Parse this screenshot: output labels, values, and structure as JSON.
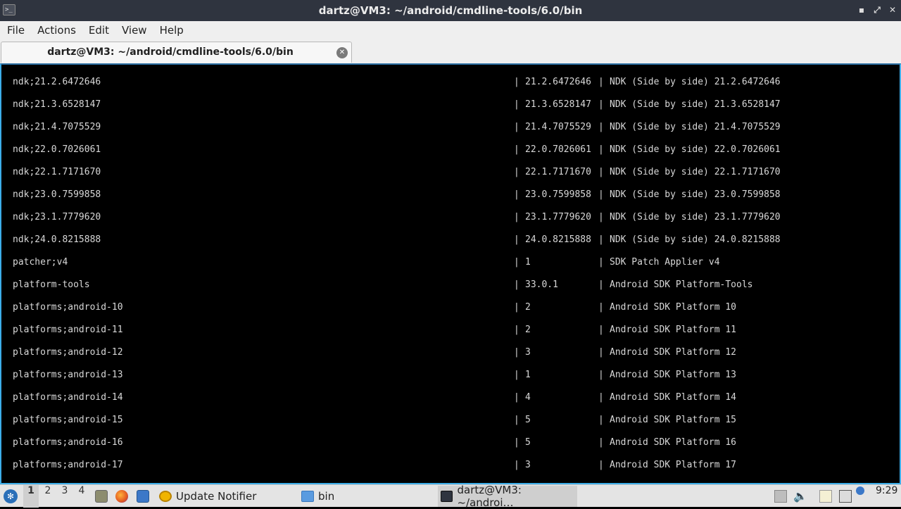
{
  "window": {
    "title": "dartz@VM3: ~/android/cmdline-tools/6.0/bin",
    "app_icon": "terminal-icon",
    "controls": {
      "minimize": "▪",
      "maximize": "⤢",
      "close": "✕"
    }
  },
  "menu": [
    "File",
    "Actions",
    "Edit",
    "View",
    "Help"
  ],
  "tab": {
    "label": "dartz@VM3: ~/android/cmdline-tools/6.0/bin",
    "close": "✕"
  },
  "terminal": {
    "separator": "|",
    "rows": [
      {
        "path": "ndk;21.2.6472646",
        "version": "21.2.6472646",
        "description": "NDK (Side by side) 21.2.6472646"
      },
      {
        "path": "ndk;21.3.6528147",
        "version": "21.3.6528147",
        "description": "NDK (Side by side) 21.3.6528147"
      },
      {
        "path": "ndk;21.4.7075529",
        "version": "21.4.7075529",
        "description": "NDK (Side by side) 21.4.7075529"
      },
      {
        "path": "ndk;22.0.7026061",
        "version": "22.0.7026061",
        "description": "NDK (Side by side) 22.0.7026061"
      },
      {
        "path": "ndk;22.1.7171670",
        "version": "22.1.7171670",
        "description": "NDK (Side by side) 22.1.7171670"
      },
      {
        "path": "ndk;23.0.7599858",
        "version": "23.0.7599858",
        "description": "NDK (Side by side) 23.0.7599858"
      },
      {
        "path": "ndk;23.1.7779620",
        "version": "23.1.7779620",
        "description": "NDK (Side by side) 23.1.7779620"
      },
      {
        "path": "ndk;24.0.8215888",
        "version": "24.0.8215888",
        "description": "NDK (Side by side) 24.0.8215888"
      },
      {
        "path": "patcher;v4",
        "version": "1",
        "description": "SDK Patch Applier v4"
      },
      {
        "path": "platform-tools",
        "version": "33.0.1",
        "description": "Android SDK Platform-Tools"
      },
      {
        "path": "platforms;android-10",
        "version": "2",
        "description": "Android SDK Platform 10"
      },
      {
        "path": "platforms;android-11",
        "version": "2",
        "description": "Android SDK Platform 11"
      },
      {
        "path": "platforms;android-12",
        "version": "3",
        "description": "Android SDK Platform 12"
      },
      {
        "path": "platforms;android-13",
        "version": "1",
        "description": "Android SDK Platform 13"
      },
      {
        "path": "platforms;android-14",
        "version": "4",
        "description": "Android SDK Platform 14"
      },
      {
        "path": "platforms;android-15",
        "version": "5",
        "description": "Android SDK Platform 15"
      },
      {
        "path": "platforms;android-16",
        "version": "5",
        "description": "Android SDK Platform 16"
      },
      {
        "path": "platforms;android-17",
        "version": "3",
        "description": "Android SDK Platform 17"
      }
    ]
  },
  "taskbar": {
    "workspaces": [
      "1",
      "2",
      "3",
      "4"
    ],
    "active_workspace": "1",
    "quick_launch": [
      "file-manager-icon",
      "firefox-icon",
      "desktop-icon"
    ],
    "tasks": [
      {
        "label": "Update Notifier",
        "icon": "update-notifier-icon"
      },
      {
        "label": "bin",
        "icon": "folder-icon"
      },
      {
        "label": "dartz@VM3: ~/androi…",
        "icon": "terminal-icon"
      }
    ],
    "tray": [
      "clipboard-icon",
      "volume-icon",
      "notes-icon",
      "network-icon"
    ],
    "clock": "9:29"
  }
}
